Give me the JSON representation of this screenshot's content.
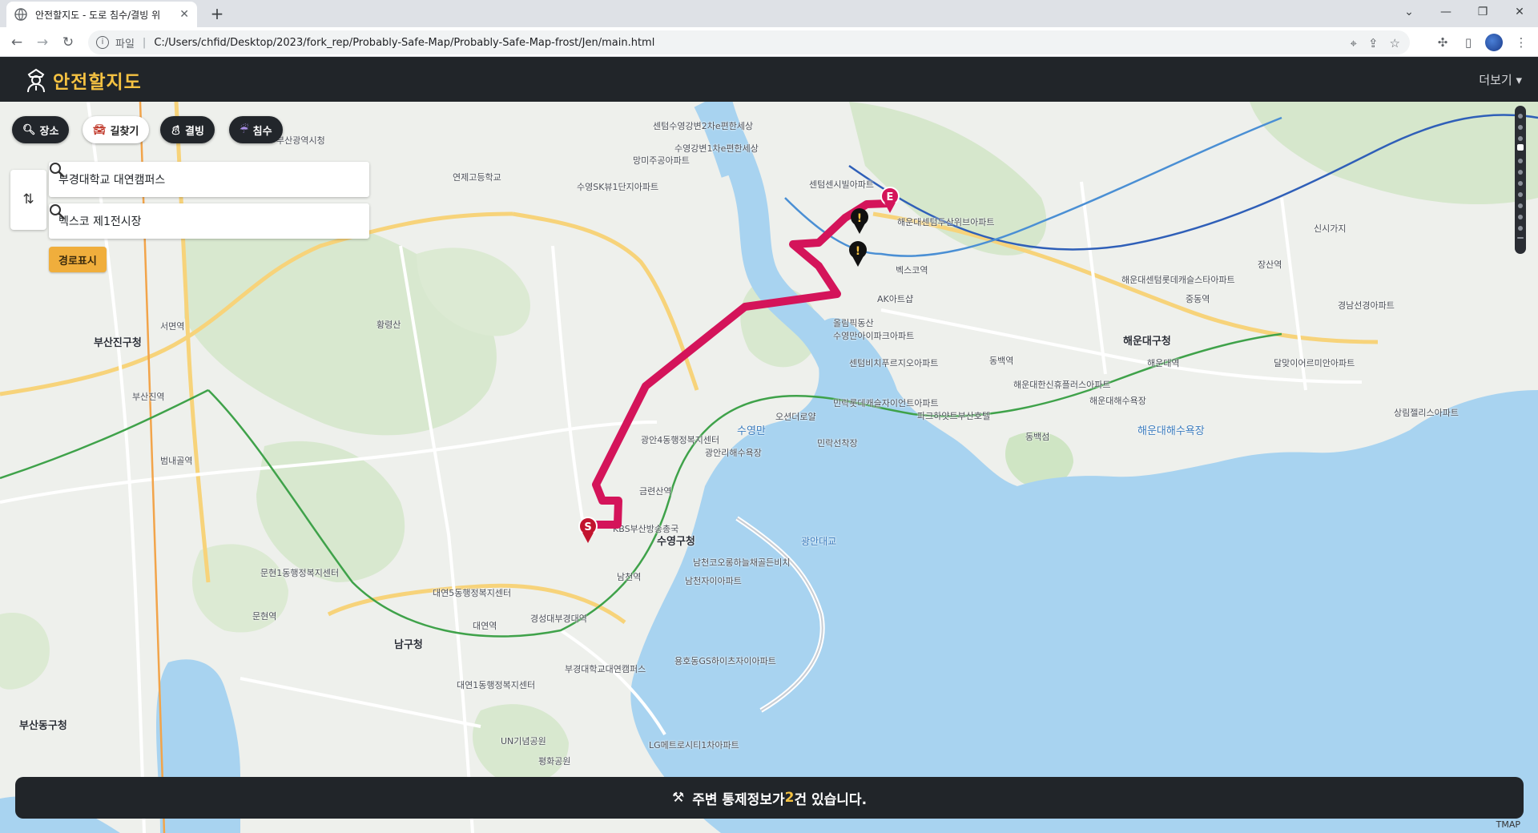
{
  "browser": {
    "tab_title": "안전할지도 - 도로 침수/결빙 위",
    "tab_close": "✕",
    "new_tab": "+",
    "url_scheme": "파일",
    "url": "C:/Users/chfid/Desktop/2023/fork_rep/Probably-Safe-Map/Probably-Safe-Map-frost/Jen/main.html",
    "window_controls": [
      "⌄",
      "—",
      "❐",
      "✕"
    ]
  },
  "header": {
    "logo_text": "안전할지도",
    "more_label": "더보기 ▾"
  },
  "modes": [
    {
      "label": "장소",
      "icon": "magnifier-icon"
    },
    {
      "label": "길찾기",
      "icon": "car-icon"
    },
    {
      "label": "결빙",
      "icon": "ice-person-icon"
    },
    {
      "label": "침수",
      "icon": "rain-icon"
    }
  ],
  "route": {
    "origin": "부경대학교 대연캠퍼스",
    "destination": "벡스코 제1전시장",
    "show_route_label": "경로표시"
  },
  "map_labels": {
    "districts": [
      "부산진구청",
      "남구청",
      "수영구청",
      "해운대구청",
      "부산동구청"
    ],
    "places": [
      "부산광역시청",
      "연제고등학교",
      "망미주공아파트",
      "수영SK뷰1단지아파트",
      "센텀수영강변2차e편한세상",
      "수영강변1차e편한세상",
      "센텀센시빌아파트",
      "해운대센텀두산위브아파트",
      "해운대센텀롯데캐슬스타아파트",
      "벡스코역",
      "AK아트샵",
      "올림픽동산",
      "수영만아이파크아파트",
      "센텀비치푸르지오아파트",
      "민락롯데캐슬자이언트아파트",
      "오션더로얄",
      "민락선착장",
      "광안리해수욕장",
      "광안4동행정복지센터",
      "금련산역",
      "KBS부산방송총국",
      "남천코오롱하늘채골든비치",
      "남천자이아파트",
      "남천역",
      "경성대부경대역",
      "부경대학교대연캠퍼스",
      "용호동GS하이츠자이아파트",
      "LG메트로시티1차아파트",
      "문현역",
      "대연역",
      "황령산",
      "부산진역",
      "서면역",
      "범내골역",
      "문현1동행정복지센터",
      "대연5동행정복지센터",
      "대연1동행정복지센터",
      "UN기념공원",
      "평화공원",
      "해운대해수욕장",
      "동백섬",
      "달맞이어르미안아파트",
      "상림젤리스아파트",
      "해운대한신휴플러스아파트",
      "파크하얏트부산호텔",
      "동백역",
      "중동역",
      "장산역",
      "해운대역",
      "신시가지",
      "경남선경아파트"
    ],
    "water": [
      "수영만",
      "광안대교",
      "해운대해수욕장"
    ]
  },
  "notice": {
    "prefix": "주변 통제정보가 ",
    "count": "2",
    "suffix": "건 있습니다."
  },
  "footer_mark": "TMAP",
  "markers": {
    "start_letter": "S",
    "end_letter": "E",
    "warning_symbol": "!"
  },
  "colors": {
    "route": "#d4145a",
    "sea": "#a8d3f0",
    "header_bg": "#212529",
    "logo": "#f5c242",
    "route_button": "#f0ae3c"
  }
}
